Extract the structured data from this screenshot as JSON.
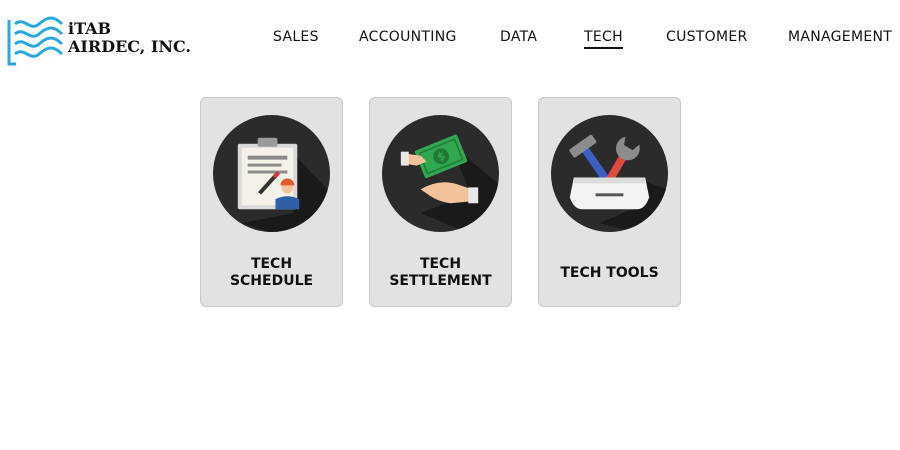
{
  "brand": {
    "line1": "iTAB",
    "line2": "AIRDEC, INC.",
    "logo_color": "#29a8e0"
  },
  "nav": {
    "items": [
      {
        "label": "SALES"
      },
      {
        "label": "ACCOUNTING"
      },
      {
        "label": "DATA"
      },
      {
        "label": "TECH",
        "active": true
      },
      {
        "label": "CUSTOMER"
      },
      {
        "label": "MANAGEMENT"
      }
    ]
  },
  "cards": [
    {
      "label": "TECH SCHEDULE",
      "icon": "clipboard-technician-icon"
    },
    {
      "label": "TECH SETTLEMENT",
      "icon": "money-hand-icon"
    },
    {
      "label": "TECH TOOLS",
      "icon": "toolbox-icon"
    }
  ],
  "colors": {
    "card_bg": "#e2e2e2",
    "icon_circle": "#2b2b2b",
    "money_green": "#2fa84f"
  }
}
